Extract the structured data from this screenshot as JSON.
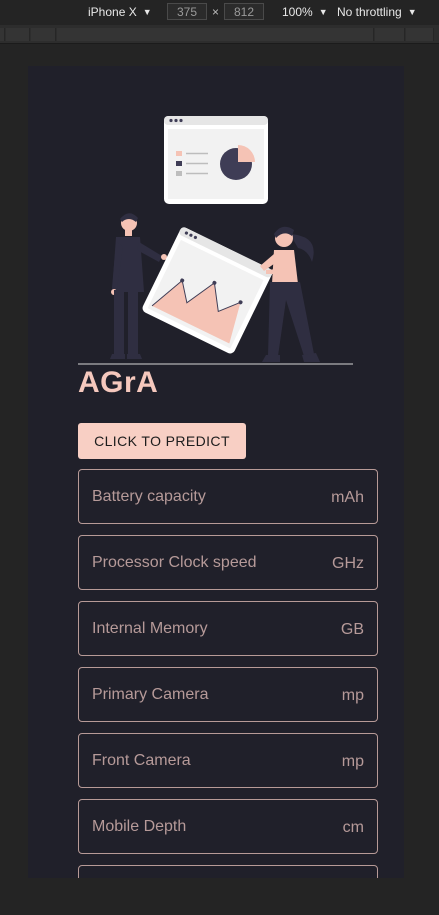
{
  "devtools": {
    "device": "iPhone X",
    "width": "375",
    "height": "812",
    "times": "×",
    "zoom": "100%",
    "throttling": "No throttling"
  },
  "app": {
    "brand": "AGrA",
    "predict_button": "CLICK TO PREDICT",
    "fields": [
      {
        "label": "Battery capacity",
        "unit": "mAh"
      },
      {
        "label": "Processor Clock speed",
        "unit": "GHz"
      },
      {
        "label": "Internal Memory",
        "unit": "GB"
      },
      {
        "label": "Primary Camera",
        "unit": "mp"
      },
      {
        "label": "Front Camera",
        "unit": "mp"
      },
      {
        "label": "Mobile Depth",
        "unit": "cm"
      },
      {
        "label": "",
        "unit": ""
      }
    ]
  },
  "colors": {
    "background": "#20202a",
    "accent": "#f8cfc4",
    "field_border": "#b79a97"
  }
}
